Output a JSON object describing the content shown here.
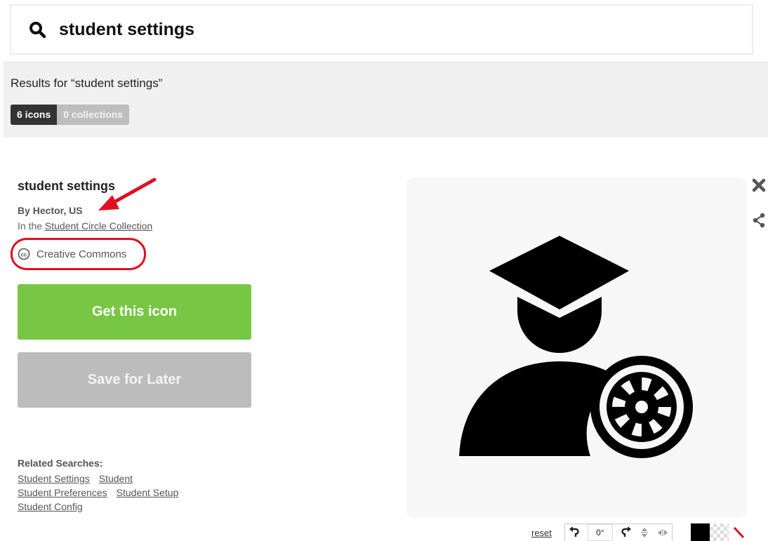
{
  "search": {
    "value": "student settings",
    "placeholder": ""
  },
  "results": {
    "title": "Results for “student settings”",
    "icons_tab": "6 icons",
    "collections_tab": "0 collections"
  },
  "detail": {
    "name": "student settings",
    "author": "By Hector, US",
    "collection_prefix": "In the ",
    "collection_link": "Student Circle Collection",
    "license": "Creative Commons",
    "get_button": "Get this icon",
    "save_button": "Save for Later"
  },
  "related": {
    "heading": "Related Searches:",
    "rows": [
      [
        "Student Settings",
        "Student"
      ],
      [
        "Student Preferences",
        "Student Setup"
      ],
      [
        "Student Config"
      ]
    ]
  },
  "toolbar": {
    "reset": "reset",
    "angle": "0°"
  },
  "icons": {
    "search": "search-icon",
    "close": "close-icon",
    "share": "share-icon",
    "license": "creative-commons-icon",
    "rotate_left": "rotate-left-icon",
    "rotate_right": "rotate-right-icon",
    "flip_vertical": "flip-vertical-icon",
    "flip_horizontal": "flip-horizontal-icon"
  },
  "colors": {
    "accent_green": "#77c744",
    "save_gray": "#bcbcbc",
    "annotation_red": "#e01020",
    "swatch_black": "#000000"
  }
}
